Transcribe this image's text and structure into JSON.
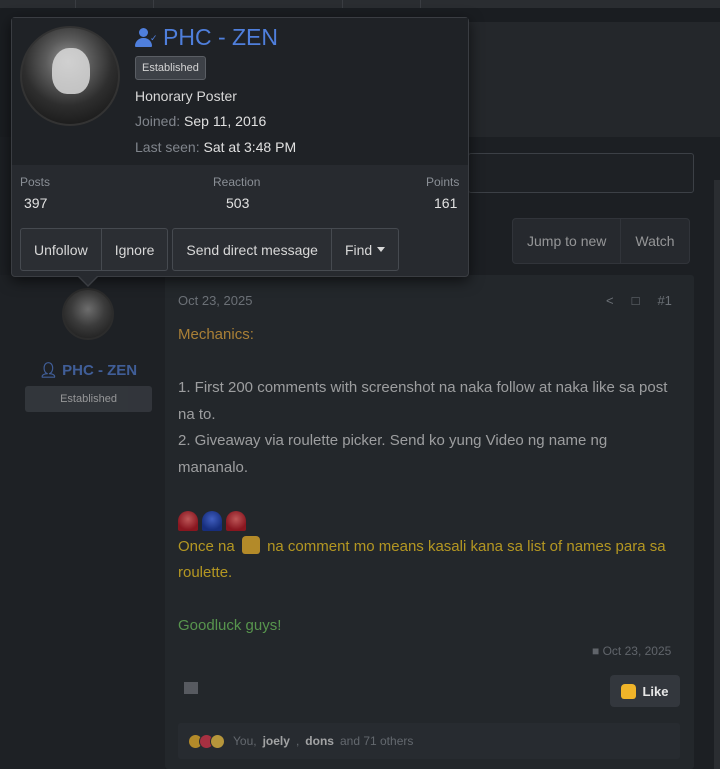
{
  "popup": {
    "username": "PHC - ZEN",
    "badge": "Established",
    "title": "Honorary Poster",
    "joined_label": "Joined:",
    "joined_value": "Sep 11, 2016",
    "last_seen_label": "Last seen:",
    "last_seen_value": "Sat at 3:48 PM",
    "stats": [
      {
        "label": "Posts",
        "value": "397"
      },
      {
        "label": "Reaction",
        "value": "503"
      },
      {
        "label": "Points",
        "value": "161"
      }
    ],
    "buttons": {
      "unfollow": "Unfollow",
      "ignore": "Ignore",
      "message": "Send direct message",
      "find": "Find"
    }
  },
  "thread_buttons": {
    "jump": "Jump to new",
    "watch": "Watch"
  },
  "sidebar_user": {
    "name": "PHC - ZEN",
    "badge": "Established"
  },
  "post": {
    "date": "Oct 23, 2025",
    "number": "#1",
    "mechanics": "Mechanics:",
    "line1": "1. First 200 comments with screenshot na naka follow at naka like sa post na to.",
    "line2": "2. Giveaway via roulette picker. Send ko yung Video ng name ng mananalo.",
    "once_before": "Once na",
    "once_after": "na comment mo means kasali kana sa list of names para sa roulette.",
    "goodluck": "Goodluck guys!",
    "edited_date": "Oct 23, 2025",
    "like_label": "Like",
    "reactions": {
      "you": "You,",
      "user1": "joely",
      "comma": ",",
      "user2": "dons",
      "others": "and 71 others"
    }
  },
  "colors": {
    "mechanics": "#e2a53b",
    "yellow_text": "#f0c61f",
    "green_text": "#6dc35c",
    "username": "#4f7fdc"
  }
}
